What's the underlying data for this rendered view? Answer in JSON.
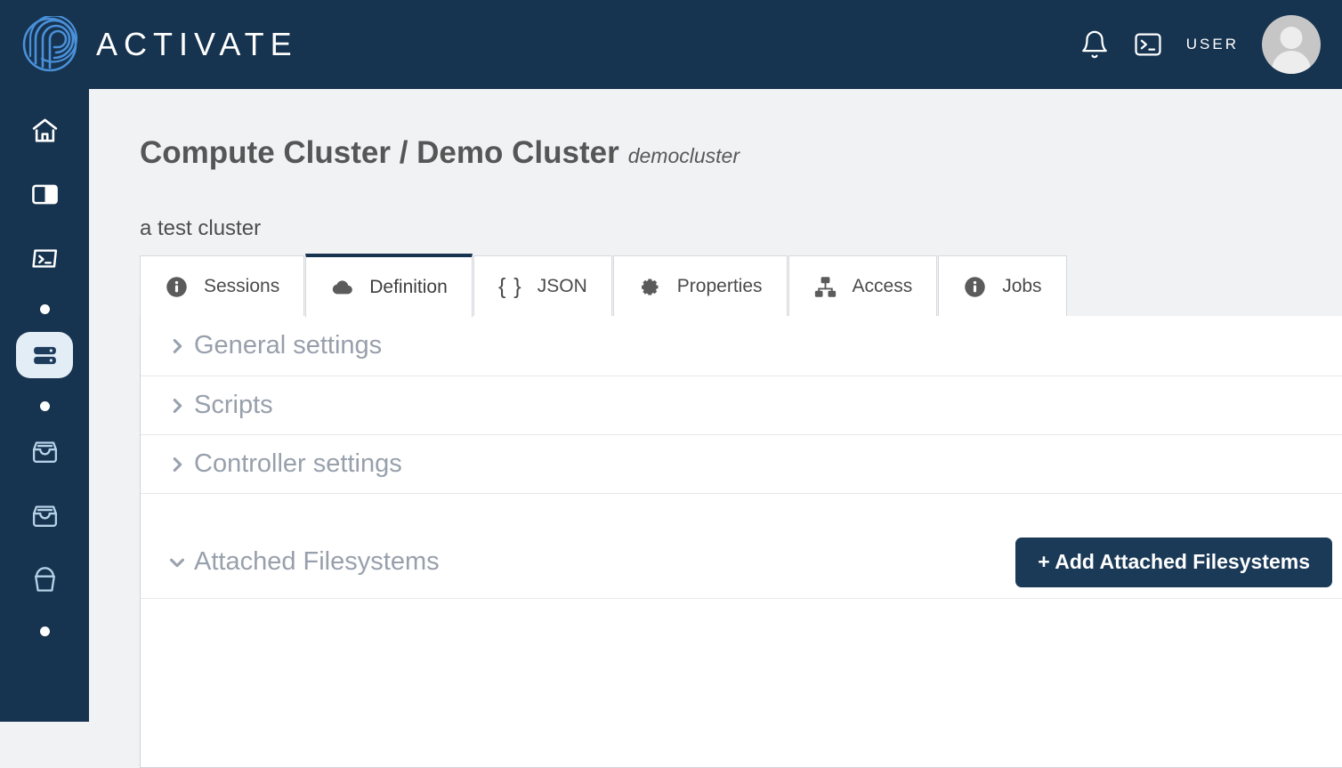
{
  "header": {
    "brand_name": "ACTIVATE",
    "logo_icon": "activate-spiral-logo",
    "notifications_icon": "bell-icon",
    "terminal_icon": "terminal-icon",
    "user_label": "USER",
    "avatar_icon": "user-avatar"
  },
  "sidebar": {
    "items": [
      {
        "icon": "home-icon",
        "name": "home",
        "active": false,
        "type": "icon"
      },
      {
        "icon": "panel-layout-icon",
        "name": "workspaces",
        "active": false,
        "type": "icon"
      },
      {
        "icon": "terminal-icon",
        "name": "terminal",
        "active": false,
        "type": "icon"
      },
      {
        "icon": "dot-icon",
        "name": "separator-1",
        "active": false,
        "type": "dot"
      },
      {
        "icon": "server-icon",
        "name": "compute-clusters",
        "active": true,
        "type": "icon"
      },
      {
        "icon": "dot-icon",
        "name": "separator-2",
        "active": false,
        "type": "dot"
      },
      {
        "icon": "inbox-tray-icon",
        "name": "filesystems",
        "active": false,
        "type": "icon"
      },
      {
        "icon": "inbox-tray-icon",
        "name": "storage",
        "active": false,
        "type": "icon"
      },
      {
        "icon": "bucket-icon",
        "name": "buckets",
        "active": false,
        "type": "icon"
      },
      {
        "icon": "dot-icon",
        "name": "separator-3",
        "active": false,
        "type": "dot"
      }
    ]
  },
  "page": {
    "title": "Compute Cluster / Demo Cluster",
    "slug": "democluster",
    "description": "a test cluster"
  },
  "tabs": [
    {
      "label": "Sessions",
      "icon": "info-circle-icon",
      "active": false
    },
    {
      "label": "Definition",
      "icon": "cloud-icon",
      "active": true
    },
    {
      "label": "JSON",
      "icon": "curly-braces-icon",
      "active": false
    },
    {
      "label": "Properties",
      "icon": "gear-icon",
      "active": false
    },
    {
      "label": "Access",
      "icon": "sitemap-icon",
      "active": false
    },
    {
      "label": "Jobs",
      "icon": "info-circle-icon",
      "active": false
    }
  ],
  "sections": [
    {
      "label": "General settings",
      "expanded": false,
      "chevron": "chevron-right-icon"
    },
    {
      "label": "Scripts",
      "expanded": false,
      "chevron": "chevron-right-icon"
    },
    {
      "label": "Controller settings",
      "expanded": false,
      "chevron": "chevron-right-icon"
    },
    {
      "label": "Attached Filesystems",
      "expanded": true,
      "chevron": "chevron-down-icon"
    }
  ],
  "actions": {
    "add_attached_filesystems": "+ Add Attached Filesystems"
  },
  "colors": {
    "brand_navy": "#16334f",
    "accent_blue": "#4a90d9",
    "page_bg": "#f1f2f4",
    "muted_text": "#98a0ac",
    "button_bg": "#1b3a58"
  }
}
